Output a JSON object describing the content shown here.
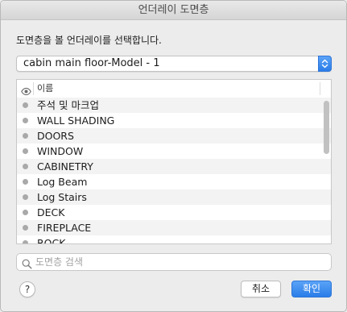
{
  "window": {
    "title": "언더레이 도면층"
  },
  "prompt": "도면층을 볼 언더레이를 선택합니다.",
  "underlay_select": {
    "selected": "cabin main floor-Model - 1",
    "stepper_icon": "up-down-chevron-icon"
  },
  "layer_table": {
    "visibility_icon": "eye-icon",
    "name_header": "이름",
    "rows": [
      {
        "label": "주석 및 마크업"
      },
      {
        "label": "WALL SHADING"
      },
      {
        "label": "DOORS"
      },
      {
        "label": "WINDOW"
      },
      {
        "label": "CABINETRY"
      },
      {
        "label": "Log Beam"
      },
      {
        "label": "Log Stairs"
      },
      {
        "label": "DECK"
      },
      {
        "label": "FIREPLACE"
      },
      {
        "label": "ROCK"
      }
    ]
  },
  "search": {
    "placeholder": "도면층 검색",
    "value": "",
    "icon": "search-icon"
  },
  "footer": {
    "help_label": "?",
    "cancel_label": "취소",
    "ok_label": "확인"
  },
  "colors": {
    "accent": "#2a7de8",
    "dot": "#a9a9a9",
    "window_bg": "#ececec"
  }
}
